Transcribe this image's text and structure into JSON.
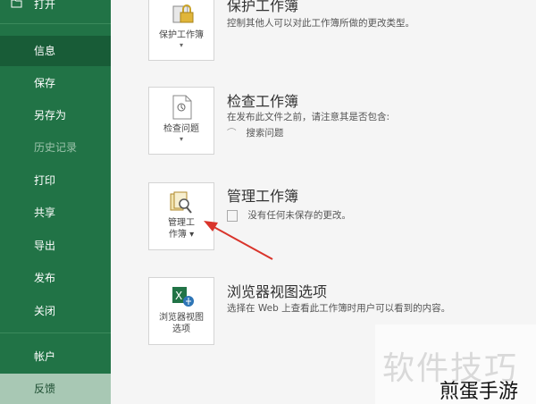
{
  "sidebar": {
    "items": [
      {
        "label": "打开"
      },
      {
        "label": "信息"
      },
      {
        "label": "保存"
      },
      {
        "label": "另存为"
      },
      {
        "label": "历史记录"
      },
      {
        "label": "打印"
      },
      {
        "label": "共享"
      },
      {
        "label": "导出"
      },
      {
        "label": "发布"
      },
      {
        "label": "关闭"
      },
      {
        "label": "帐户"
      },
      {
        "label": "反馈"
      }
    ]
  },
  "sections": {
    "protect": {
      "tile_label": "保护工作簿",
      "title": "保护工作簿",
      "description": "控制其他人可以对此工作簿所做的更改类型。"
    },
    "inspect": {
      "tile_label_1": "检查问题",
      "title": "检查工作簿",
      "description": "在发布此文件之前，请注意其是否包含:",
      "sub_item": "搜索问题"
    },
    "manage": {
      "tile_label_1": "管理工",
      "tile_label_2": "作簿",
      "title": "管理工作簿",
      "sub_item": "没有任何未保存的更改。"
    },
    "browser": {
      "tile_label_1": "浏览器视图",
      "tile_label_2": "选项",
      "title": "浏览器视图选项",
      "description": "选择在 Web 上查看此工作簿时用户可以看到的内容。"
    }
  },
  "watermark": {
    "big": "软件技巧",
    "small": "煎蛋手游"
  },
  "colors": {
    "sidebar": "#217346",
    "sidebar_active": "#185c37",
    "arrow": "#d9342b"
  }
}
